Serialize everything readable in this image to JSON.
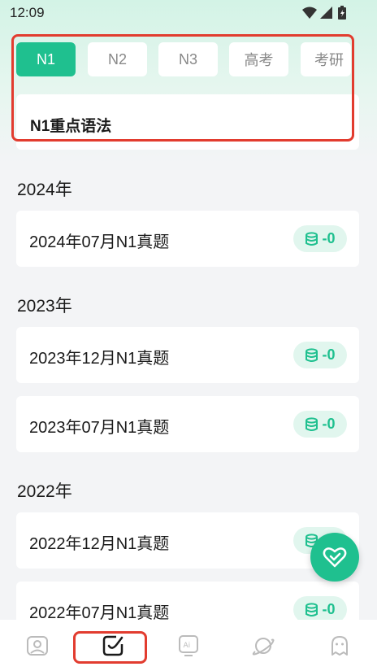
{
  "status_bar": {
    "time": "12:09"
  },
  "tabs": [
    {
      "label": "N1",
      "active": true
    },
    {
      "label": "N2",
      "active": false
    },
    {
      "label": "N3",
      "active": false
    },
    {
      "label": "高考",
      "active": false
    },
    {
      "label": "考研",
      "active": false
    }
  ],
  "featured": {
    "title": "N1重点语法"
  },
  "sections": [
    {
      "year": "2024年",
      "items": [
        {
          "title": "2024年07月N1真题",
          "badge": "-0"
        }
      ]
    },
    {
      "year": "2023年",
      "items": [
        {
          "title": "2023年12月N1真题",
          "badge": "-0"
        },
        {
          "title": "2023年07月N1真题",
          "badge": "-0"
        }
      ]
    },
    {
      "year": "2022年",
      "items": [
        {
          "title": "2022年12月N1真题",
          "badge": "-0"
        },
        {
          "title": "2022年07月N1真题",
          "badge": "-0"
        }
      ]
    }
  ],
  "bottom_nav": [
    {
      "icon": "profile-card-icon",
      "active": false
    },
    {
      "icon": "check-note-icon",
      "active": true
    },
    {
      "icon": "ai-board-icon",
      "active": false
    },
    {
      "icon": "planet-icon",
      "active": false
    },
    {
      "icon": "ghost-icon",
      "active": false
    }
  ],
  "colors": {
    "accent": "#1fc08f",
    "highlight": "#e23c2f",
    "badge_bg": "#e1f6ee",
    "background": "#f3f4f6"
  }
}
